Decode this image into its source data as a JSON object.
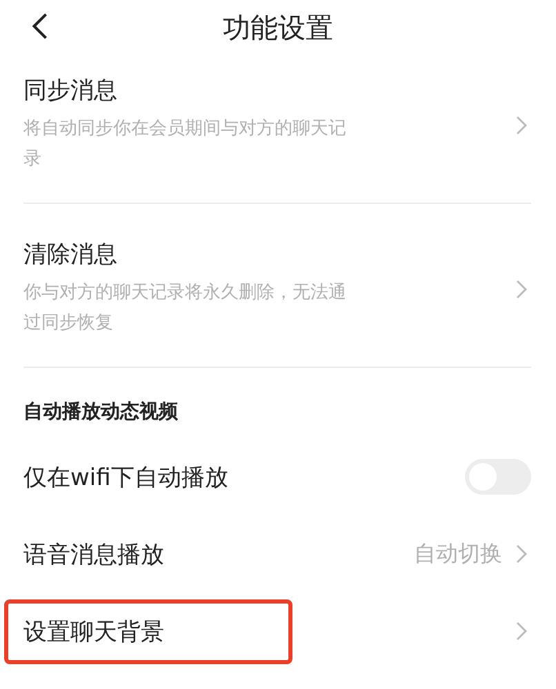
{
  "header": {
    "title": "功能设置"
  },
  "items": [
    {
      "kind": "detail",
      "title": "同步消息",
      "description": "将自动同步你在会员期间与对方的聊天记录"
    },
    {
      "kind": "detail",
      "title": "清除消息",
      "description": "你与对方的聊天记录将永久删除，无法通过同步恢复"
    },
    {
      "kind": "section",
      "title": "自动播放动态视频"
    },
    {
      "kind": "toggle",
      "title": "仅在wifi下自动播放",
      "on": false
    },
    {
      "kind": "value",
      "title": "语音消息播放",
      "value": "自动切换"
    },
    {
      "kind": "link",
      "title": "设置聊天背景",
      "highlighted": true
    }
  ]
}
